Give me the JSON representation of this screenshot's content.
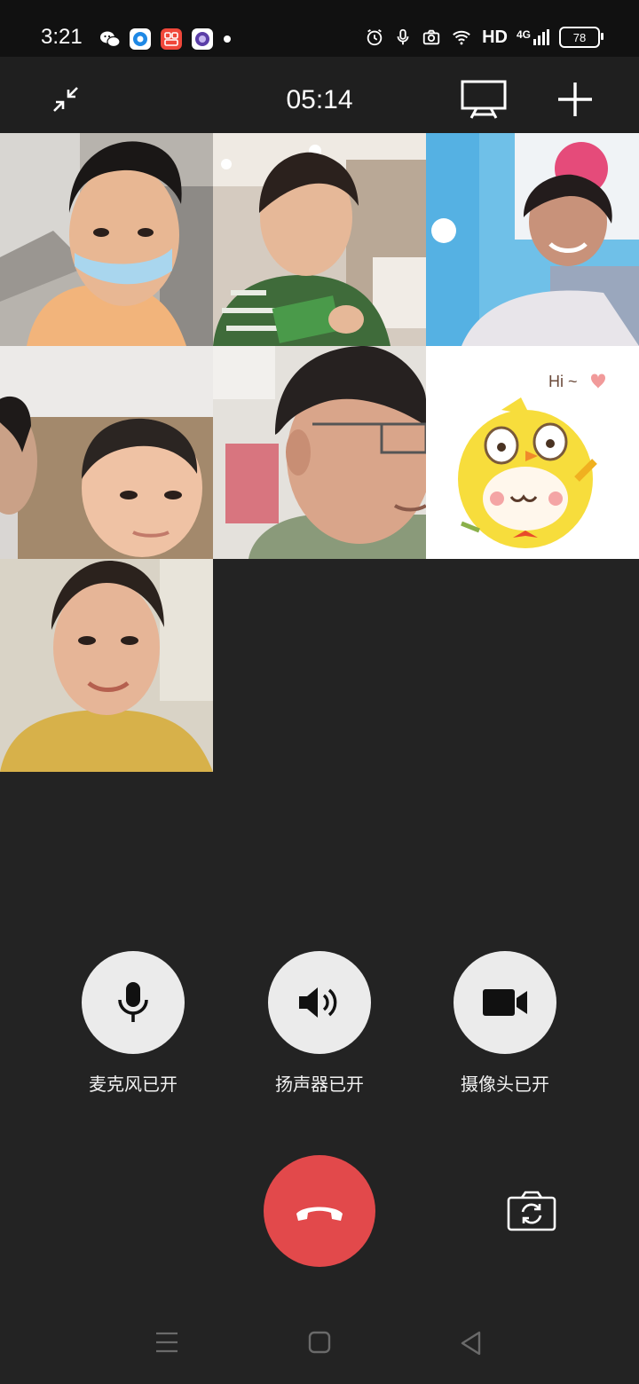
{
  "status_bar": {
    "time": "3:21",
    "network_label": "HD",
    "signal_type": "4G",
    "battery_level": "78",
    "icons": [
      "wechat-icon",
      "blue-app-icon",
      "red-app-icon",
      "purple-app-icon",
      "alarm-icon",
      "mic-indicator-icon",
      "camera-indicator-icon",
      "wifi-icon",
      "signal-icon"
    ]
  },
  "call": {
    "duration": "05:14",
    "participants_count": 7
  },
  "controls": {
    "mic_label": "麦克风已开",
    "speaker_label": "扬声器已开",
    "camera_label": "摄像头已开"
  },
  "colors": {
    "background": "#232323",
    "hangup": "#e2494b",
    "control_circle": "#ebebeb"
  }
}
